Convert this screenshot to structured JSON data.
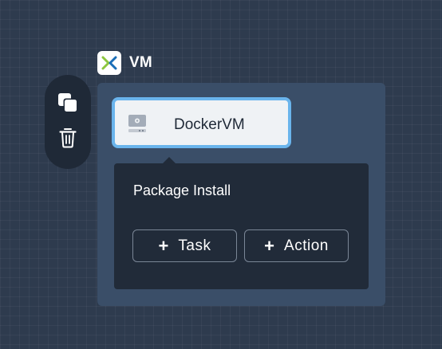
{
  "toolbar": {
    "copy_icon": "copy-icon",
    "trash_icon": "trash-icon"
  },
  "vm": {
    "logo_icon": "nutanix-x-logo",
    "title": "VM",
    "service": {
      "icon": "server-icon",
      "name": "DockerVM"
    }
  },
  "popover": {
    "title": "Package Install",
    "buttons": [
      {
        "icon": "plus",
        "label": "Task"
      },
      {
        "icon": "plus",
        "label": "Action"
      }
    ]
  },
  "colors": {
    "background": "#2e3b4e",
    "container": "#3a4e68",
    "popover": "#212b39",
    "selection_border": "#6ab4ec",
    "logo_green": "#8cc63f",
    "logo_blue": "#1a6eb7"
  }
}
